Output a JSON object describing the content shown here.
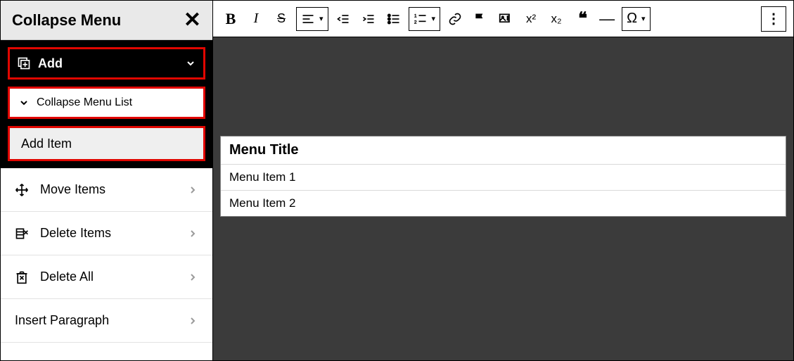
{
  "sidebar": {
    "title": "Collapse Menu",
    "add_label": "Add",
    "list_label": "Collapse Menu List",
    "add_item_label": "Add Item",
    "actions": [
      {
        "label": "Move Items",
        "icon": "move-icon"
      },
      {
        "label": "Delete Items",
        "icon": "delete-items-icon"
      },
      {
        "label": "Delete All",
        "icon": "delete-all-icon"
      },
      {
        "label": "Insert Paragraph",
        "icon": null
      }
    ]
  },
  "toolbar": {
    "bold": "B",
    "italic": "I",
    "strike": "S",
    "omega": "Ω",
    "quote": "“",
    "sup": "x²",
    "sub": "x₂"
  },
  "widget": {
    "title": "Menu Title",
    "rows": [
      "Menu Item 1",
      "Menu Item 2"
    ]
  }
}
